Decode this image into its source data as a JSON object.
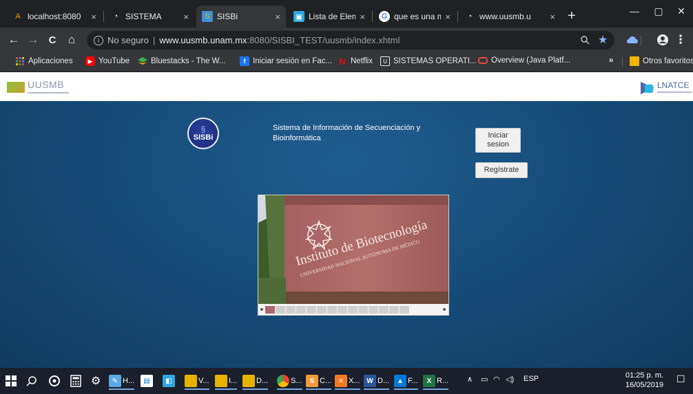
{
  "browser": {
    "tabs": [
      {
        "label": "localhost:8080",
        "favicon": "A",
        "active": false
      },
      {
        "label": "SISTEMA",
        "favicon": "◔",
        "active": false
      },
      {
        "label": "SISBi",
        "favicon": "S",
        "active": true
      },
      {
        "label": "Lista de Elemen",
        "favicon": "▣",
        "active": false
      },
      {
        "label": "que es una mu",
        "favicon": "G",
        "active": false
      },
      {
        "label": "www.uusmb.u",
        "favicon": "◔",
        "active": false
      }
    ],
    "close_glyph": "×",
    "new_tab_glyph": "+",
    "window_controls": {
      "minimize": "—",
      "maximize": "▢",
      "close": "✕"
    },
    "address": {
      "security_label": "No seguro",
      "host": "www.uusmb.unam.mx",
      "path": ":8080/SISBI_TEST/uusmb/index.xhtml"
    },
    "nav": {
      "back": "←",
      "forward": "→",
      "reload": "C",
      "home": "⌂"
    },
    "bookmarks": [
      {
        "label": "Aplicaciones",
        "icon": "apps-icon",
        "color": "#e8453c"
      },
      {
        "label": "YouTube",
        "icon": "youtube-icon",
        "color": "#ff0000"
      },
      {
        "label": "Bluestacks - The W...",
        "icon": "bluestacks-icon",
        "color": "#3fae49"
      },
      {
        "label": "Iniciar sesión en Fac...",
        "icon": "facebook-icon",
        "color": "#1877f2"
      },
      {
        "label": "Netflix",
        "icon": "netflix-icon",
        "color": "#e50914"
      },
      {
        "label": "SISTEMAS OPERATI...",
        "icon": "bookmark-page-icon",
        "color": "#9aa0a6"
      },
      {
        "label": "Overview (Java Platf...",
        "icon": "oracle-icon",
        "color": "#e84c3d"
      }
    ],
    "bookmarks_overflow": "»",
    "other_bookmarks": "Otros favoritos"
  },
  "page": {
    "header": {
      "left_logo_name": "UUSMB",
      "right_logo_name": "LNATCE"
    },
    "sisbi_logo": "SISBi",
    "title": "Sistema de Información de Secuenciación y Bioinformática",
    "login_button": "Iniciar sesion",
    "register_button": "Regístrate",
    "slider": {
      "image_text_main": "Instituto de Biotecnología",
      "image_text_sub": "UNIVERSIDAD NACIONAL AUTÓNOMA DE MÉXICO",
      "thumbnail_count": 14
    }
  },
  "taskbar": {
    "apps": [
      {
        "label": "H...",
        "icon": "paint-icon",
        "color": "#5aa9e6"
      },
      {
        "label": "V...",
        "icon": "folder-icon",
        "color": "#e8b100"
      },
      {
        "label": "I...",
        "icon": "folder-icon",
        "color": "#e8b100"
      },
      {
        "label": "D...",
        "icon": "folder-icon",
        "color": "#e8b100"
      },
      {
        "label": "S...",
        "icon": "chrome-icon",
        "color": "#4285f4"
      },
      {
        "label": "C...",
        "icon": "sublime-icon",
        "color": "#f29a3c"
      },
      {
        "label": "X...",
        "icon": "xampp-icon",
        "color": "#f47a20"
      },
      {
        "label": "D...",
        "icon": "word-icon",
        "color": "#2b579a"
      },
      {
        "label": "F...",
        "icon": "photos-icon",
        "color": "#0078d7"
      },
      {
        "label": "R...",
        "icon": "excel-icon",
        "color": "#217346"
      }
    ],
    "language": "ESP",
    "time": "01:25 p. m.",
    "date": "16/05/2019"
  }
}
